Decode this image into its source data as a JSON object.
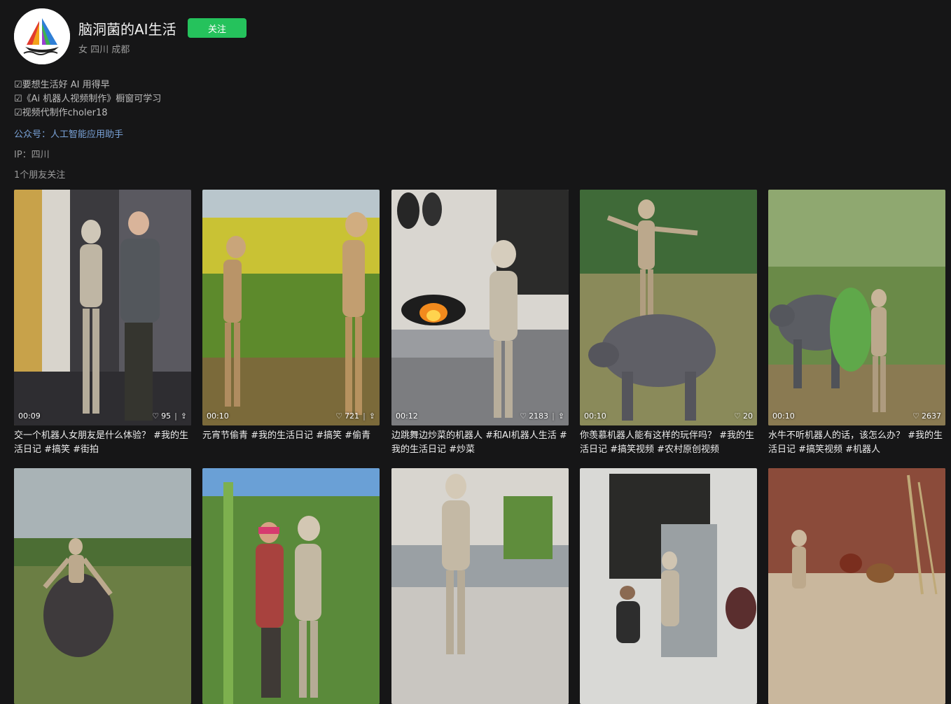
{
  "profile": {
    "name": "脑洞菌的AI生活",
    "follow_label": "关注",
    "meta": "女 四川 成都",
    "bio": [
      "☑要想生活好 AI 用得早",
      "☑《Ai 机器人视频制作》橱窗可学习",
      "☑视频代制作choler18"
    ],
    "official": "公众号：人工智能应用助手",
    "ip": "IP：四川",
    "friends": "1个朋友关注",
    "colors": {
      "follow": "#25c25c",
      "link": "#7aa3d8",
      "background": "#161617"
    }
  },
  "videos": [
    {
      "duration": "00:09",
      "likes": "95",
      "caption": "交一个机器人女朋友是什么体验？ #我的生活日记 #搞笑 #街拍"
    },
    {
      "duration": "00:10",
      "likes": "721",
      "caption": "元宵节偷青 #我的生活日记 #搞笑 #偷青"
    },
    {
      "duration": "00:12",
      "likes": "2183",
      "caption": "边跳舞边炒菜的机器人 #和AI机器人生活 #我的生活日记 #炒菜"
    },
    {
      "duration": "00:10",
      "likes": "20",
      "caption": "你羡慕机器人能有这样的玩伴吗？ #我的生活日记 #搞笑视频 #农村原创视频"
    },
    {
      "duration": "00:10",
      "likes": "2637",
      "caption": "水牛不听机器人的话，该怎么办？ #我的生活日记 #搞笑视频 #机器人"
    },
    {
      "duration": "",
      "likes": "",
      "caption": ""
    },
    {
      "duration": "",
      "likes": "",
      "caption": ""
    },
    {
      "duration": "",
      "likes": "",
      "caption": ""
    },
    {
      "duration": "",
      "likes": "",
      "caption": ""
    },
    {
      "duration": "",
      "likes": "",
      "caption": ""
    }
  ]
}
